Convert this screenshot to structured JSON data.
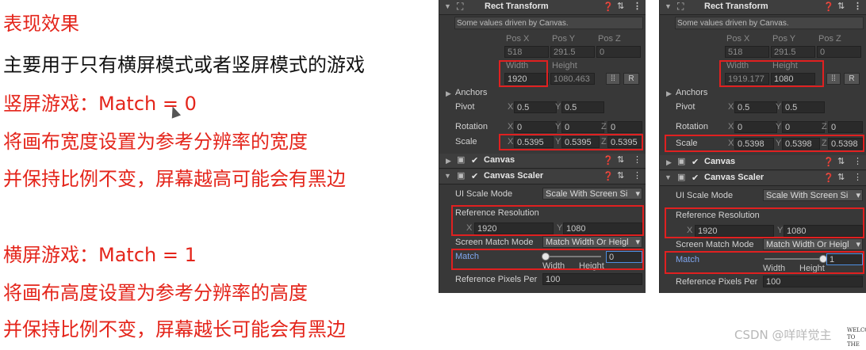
{
  "slide": {
    "title": "表现效果",
    "subtitle": "主要用于只有横屏模式或者竖屏模式的游戏",
    "portrait_heading": "竖屏游戏：Match = 0",
    "portrait_line1": "将画布宽度设置为参考分辨率的宽度",
    "portrait_line2": "并保持比例不变，屏幕越高可能会有黑边",
    "landscape_heading": "横屏游戏：Match = 1",
    "landscape_line1": "将画布高度设置为参考分辨率的高度",
    "landscape_line2": "并保持比例不变，屏幕越长可能会有黑边"
  },
  "panels": [
    {
      "rect_title": "Rect Transform",
      "info": "Some values driven by Canvas.",
      "pos_x_label": "Pos X",
      "pos_y_label": "Pos Y",
      "pos_z_label": "Pos Z",
      "pos_x": "518",
      "pos_y": "291.5",
      "pos_z": "0",
      "width_label": "Width",
      "height_label": "Height",
      "width": "1920",
      "height": "1080.463",
      "r_button": "R",
      "anchors": "Anchors",
      "pivot": "Pivot",
      "pivot_x": "0.5",
      "pivot_y": "0.5",
      "rotation": "Rotation",
      "rot_x": "0",
      "rot_y": "0",
      "rot_z": "0",
      "scale": "Scale",
      "scale_x": "0.5395",
      "scale_y": "0.5395",
      "scale_z": "0.5395",
      "axis_x": "X",
      "axis_y": "Y",
      "axis_z": "Z",
      "canvas_title": "Canvas",
      "scaler_title": "Canvas Scaler",
      "ui_scale_mode_label": "UI Scale Mode",
      "ui_scale_mode": "Scale With Screen Si",
      "ref_res_label": "Reference Resolution",
      "ref_x": "1920",
      "ref_y": "1080",
      "screen_match_label": "Screen Match Mode",
      "screen_match": "Match Width Or Heigl",
      "match_label": "Match",
      "match_value": "0",
      "match_fraction": 0,
      "slider_width": "Width",
      "slider_height": "Height",
      "ref_ppu_label": "Reference Pixels Per",
      "ref_ppu": "100"
    },
    {
      "rect_title": "Rect Transform",
      "info": "Some values driven by Canvas.",
      "pos_x_label": "Pos X",
      "pos_y_label": "Pos Y",
      "pos_z_label": "Pos Z",
      "pos_x": "518",
      "pos_y": "291.5",
      "pos_z": "0",
      "width_label": "Width",
      "height_label": "Height",
      "width": "1919.177",
      "height": "1080",
      "r_button": "R",
      "anchors": "Anchors",
      "pivot": "Pivot",
      "pivot_x": "0.5",
      "pivot_y": "0.5",
      "rotation": "Rotation",
      "rot_x": "0",
      "rot_y": "0",
      "rot_z": "0",
      "scale": "Scale",
      "scale_x": "0.5398",
      "scale_y": "0.5398",
      "scale_z": "0.5398",
      "axis_x": "X",
      "axis_y": "Y",
      "axis_z": "Z",
      "canvas_title": "Canvas",
      "scaler_title": "Canvas Scaler",
      "ui_scale_mode_label": "UI Scale Mode",
      "ui_scale_mode": "Scale With Screen Si",
      "ref_res_label": "Reference Resolution",
      "ref_x": "1920",
      "ref_y": "1080",
      "screen_match_label": "Screen Match Mode",
      "screen_match": "Match Width Or Heigl",
      "match_label": "Match",
      "match_value": "1",
      "match_fraction": 1,
      "slider_width": "Width",
      "slider_height": "Height",
      "ref_ppu_label": "Reference Pixels Per",
      "ref_ppu": "100"
    }
  ],
  "watermark": "CSDN @咩咩觉主",
  "corner_logo": "WELCOME TO THE",
  "colors": {
    "accent_red": "#e4251b",
    "highlight_red": "#e02020",
    "panel_bg": "#383838",
    "match_blue": "#7fa6ef"
  },
  "icons": [
    "collapse-triangle-icon",
    "rect-transform-icon",
    "help-icon",
    "settings-sliders-icon",
    "more-vert-icon",
    "canvas-component-icon",
    "checkbox-icon",
    "blueprint-icon"
  ]
}
